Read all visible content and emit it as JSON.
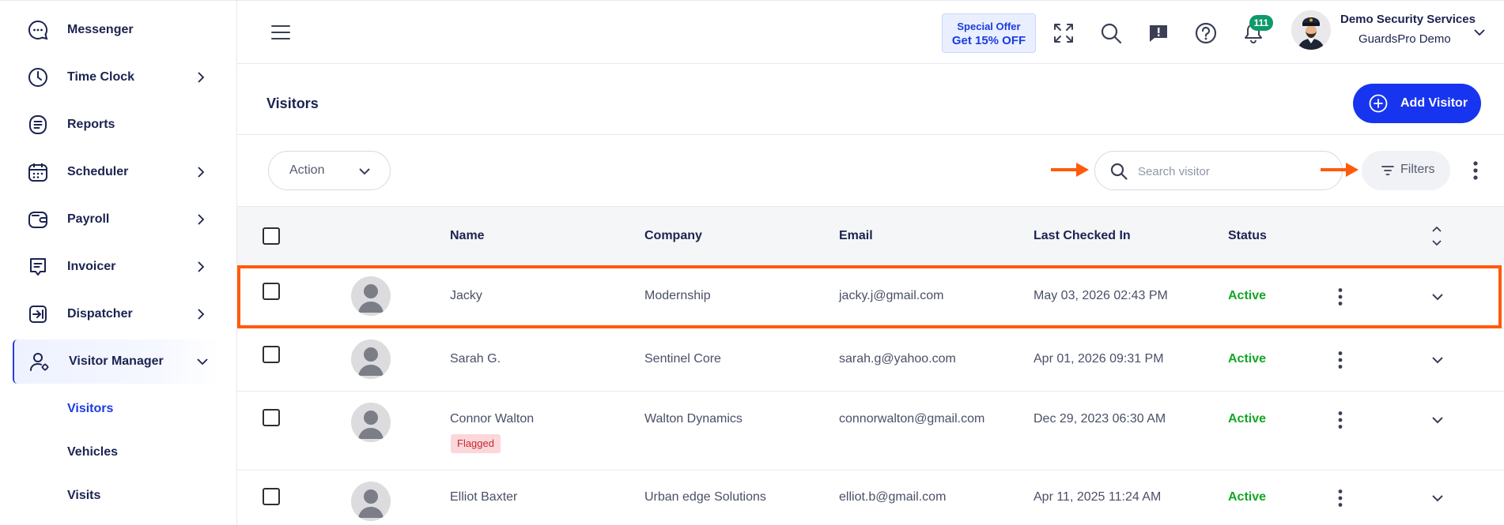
{
  "sidebar": {
    "items": [
      {
        "label": "Messenger",
        "icon": "messenger-icon",
        "has_chevron": false
      },
      {
        "label": "Time Clock",
        "icon": "clock-icon",
        "has_chevron": true
      },
      {
        "label": "Reports",
        "icon": "reports-icon",
        "has_chevron": false
      },
      {
        "label": "Scheduler",
        "icon": "calendar-icon",
        "has_chevron": true
      },
      {
        "label": "Payroll",
        "icon": "wallet-icon",
        "has_chevron": true
      },
      {
        "label": "Invoicer",
        "icon": "invoice-icon",
        "has_chevron": true
      },
      {
        "label": "Dispatcher",
        "icon": "dispatch-icon",
        "has_chevron": true
      },
      {
        "label": "Visitor Manager",
        "icon": "visitor-manager-icon",
        "has_chevron": true,
        "expanded": true,
        "active": true
      }
    ],
    "sub_items": [
      {
        "label": "Visitors",
        "active": true
      },
      {
        "label": "Vehicles",
        "active": false
      },
      {
        "label": "Visits",
        "active": false
      }
    ]
  },
  "topbar": {
    "offer_line1": "Special Offer",
    "offer_line2": "Get 15% OFF",
    "notification_count": "111",
    "company_name": "Demo Security Services",
    "account_name": "GuardsPro Demo"
  },
  "page": {
    "title": "Visitors",
    "add_button_label": "Add Visitor"
  },
  "toolbar": {
    "action_label": "Action",
    "search_placeholder": "Search visitor",
    "search_value": "",
    "filters_label": "Filters"
  },
  "table": {
    "columns": [
      "Name",
      "Company",
      "Email",
      "Last Checked In",
      "Status"
    ],
    "rows": [
      {
        "name": "Jacky",
        "company": "Modernship",
        "email": "jacky.j@gmail.com",
        "last_checked_in": "May 03, 2026 02:43 PM",
        "status": "Active",
        "flag": ""
      },
      {
        "name": "Sarah G.",
        "company": "Sentinel Core",
        "email": "sarah.g@yahoo.com",
        "last_checked_in": "Apr 01, 2026 09:31 PM",
        "status": "Active",
        "flag": ""
      },
      {
        "name": "Connor Walton",
        "company": "Walton Dynamics",
        "email": "connorwalton@gmail.com",
        "last_checked_in": "Dec 29, 2023 06:30 AM",
        "status": "Active",
        "flag": "Flagged"
      },
      {
        "name": "Elliot Baxter",
        "company": "Urban edge Solutions",
        "email": "elliot.b@gmail.com",
        "last_checked_in": "Apr 11, 2025 11:24 AM",
        "status": "Active",
        "flag": ""
      }
    ]
  },
  "colors": {
    "accent": "#1734ef",
    "status_active": "#14a626",
    "highlight": "#ff5b0a",
    "flag_bg": "#fbd7d9",
    "notification_badge": "#0e9a6b"
  }
}
